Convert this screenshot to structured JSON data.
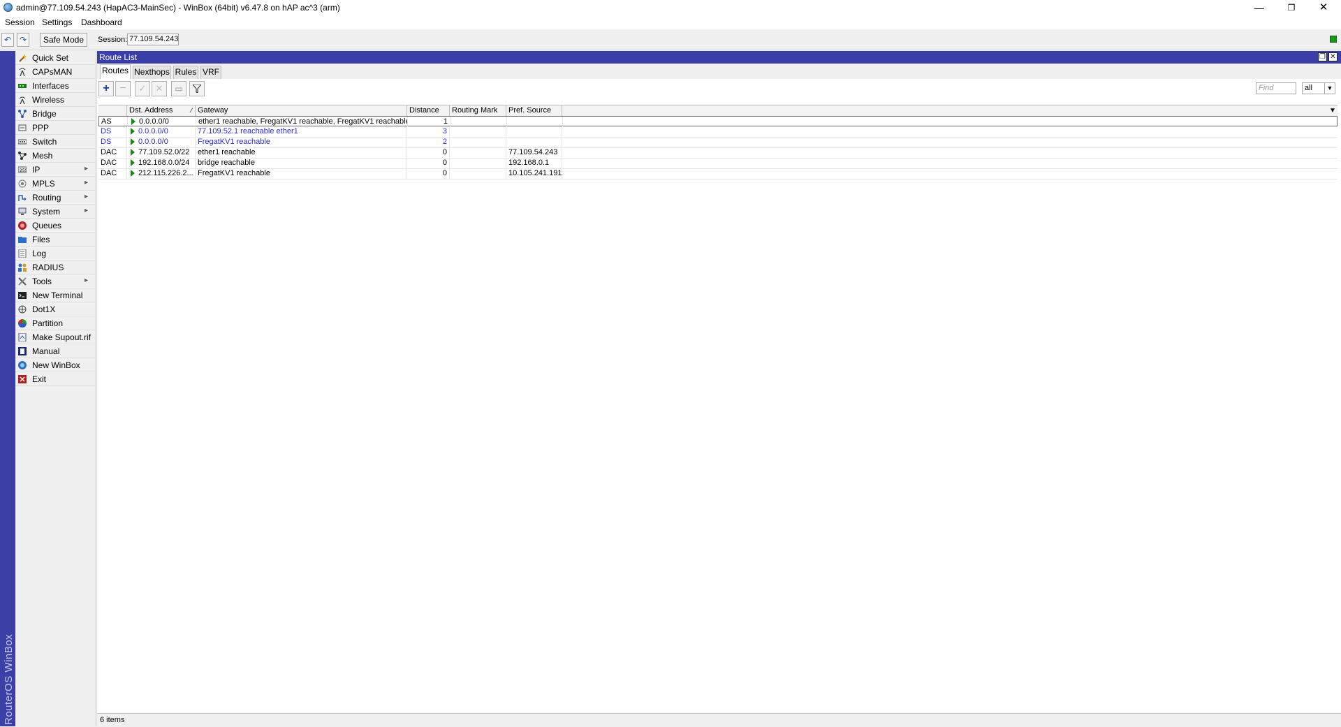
{
  "window": {
    "title": "admin@77.109.54.243 (HapAC3-MainSec) - WinBox (64bit) v6.47.8 on hAP ac^3 (arm)",
    "minimize": "—",
    "maximize": "❐",
    "close": "✕"
  },
  "menu": [
    "Session",
    "Settings",
    "Dashboard"
  ],
  "toolbar": {
    "undo": "↶",
    "redo": "↷",
    "safe_mode": "Safe Mode",
    "session_label": "Session:",
    "session_value": "77.109.54.243"
  },
  "brand": "RouterOS WinBox",
  "sidebar": [
    {
      "label": "Quick Set",
      "icon": "wand-icon",
      "submenu": false
    },
    {
      "label": "CAPsMAN",
      "icon": "antenna-icon",
      "submenu": false
    },
    {
      "label": "Interfaces",
      "icon": "interfaces-icon",
      "submenu": false
    },
    {
      "label": "Wireless",
      "icon": "wireless-icon",
      "submenu": false
    },
    {
      "label": "Bridge",
      "icon": "bridge-icon",
      "submenu": false
    },
    {
      "label": "PPP",
      "icon": "ppp-icon",
      "submenu": false
    },
    {
      "label": "Switch",
      "icon": "switch-icon",
      "submenu": false
    },
    {
      "label": "Mesh",
      "icon": "mesh-icon",
      "submenu": false
    },
    {
      "label": "IP",
      "icon": "ip-icon",
      "submenu": true
    },
    {
      "label": "MPLS",
      "icon": "mpls-icon",
      "submenu": true
    },
    {
      "label": "Routing",
      "icon": "routing-icon",
      "submenu": true
    },
    {
      "label": "System",
      "icon": "system-icon",
      "submenu": true
    },
    {
      "label": "Queues",
      "icon": "queues-icon",
      "submenu": false
    },
    {
      "label": "Files",
      "icon": "files-icon",
      "submenu": false
    },
    {
      "label": "Log",
      "icon": "log-icon",
      "submenu": false
    },
    {
      "label": "RADIUS",
      "icon": "radius-icon",
      "submenu": false
    },
    {
      "label": "Tools",
      "icon": "tools-icon",
      "submenu": true
    },
    {
      "label": "New Terminal",
      "icon": "terminal-icon",
      "submenu": false
    },
    {
      "label": "Dot1X",
      "icon": "dot1x-icon",
      "submenu": false
    },
    {
      "label": "Partition",
      "icon": "partition-icon",
      "submenu": false
    },
    {
      "label": "Make Supout.rif",
      "icon": "supout-icon",
      "submenu": false
    },
    {
      "label": "Manual",
      "icon": "manual-icon",
      "submenu": false
    },
    {
      "label": "New WinBox",
      "icon": "winbox-icon",
      "submenu": false
    },
    {
      "label": "Exit",
      "icon": "exit-icon",
      "submenu": false
    }
  ],
  "route_list": {
    "title": "Route List",
    "tabs": [
      "Routes",
      "Nexthops",
      "Rules",
      "VRF"
    ],
    "find_placeholder": "Find",
    "filter_value": "all",
    "columns": [
      "Dst. Address",
      "Gateway",
      "Distance",
      "Routing Mark",
      "Pref. Source"
    ],
    "rows": [
      {
        "flags": "AS",
        "dst": "0.0.0.0/0",
        "gateway": "ether1 reachable, FregatKV1 reachable, FregatKV1 reachable",
        "distance": "1",
        "mark": "",
        "pref": "",
        "style": "normal"
      },
      {
        "flags": "DS",
        "dst": "0.0.0.0/0",
        "gateway": "77.109.52.1 reachable ether1",
        "distance": "3",
        "mark": "",
        "pref": "",
        "style": "blue"
      },
      {
        "flags": "DS",
        "dst": "0.0.0.0/0",
        "gateway": "FregatKV1 reachable",
        "distance": "2",
        "mark": "",
        "pref": "",
        "style": "blue"
      },
      {
        "flags": "DAC",
        "dst": "77.109.52.0/22",
        "gateway": "ether1 reachable",
        "distance": "0",
        "mark": "",
        "pref": "77.109.54.243",
        "style": "normal"
      },
      {
        "flags": "DAC",
        "dst": "192.168.0.0/24",
        "gateway": "bridge reachable",
        "distance": "0",
        "mark": "",
        "pref": "192.168.0.1",
        "style": "normal"
      },
      {
        "flags": "DAC",
        "dst": "212.115.226.2...",
        "gateway": "FregatKV1 reachable",
        "distance": "0",
        "mark": "",
        "pref": "10.105.241.191",
        "style": "normal"
      }
    ],
    "status": "6 items"
  }
}
